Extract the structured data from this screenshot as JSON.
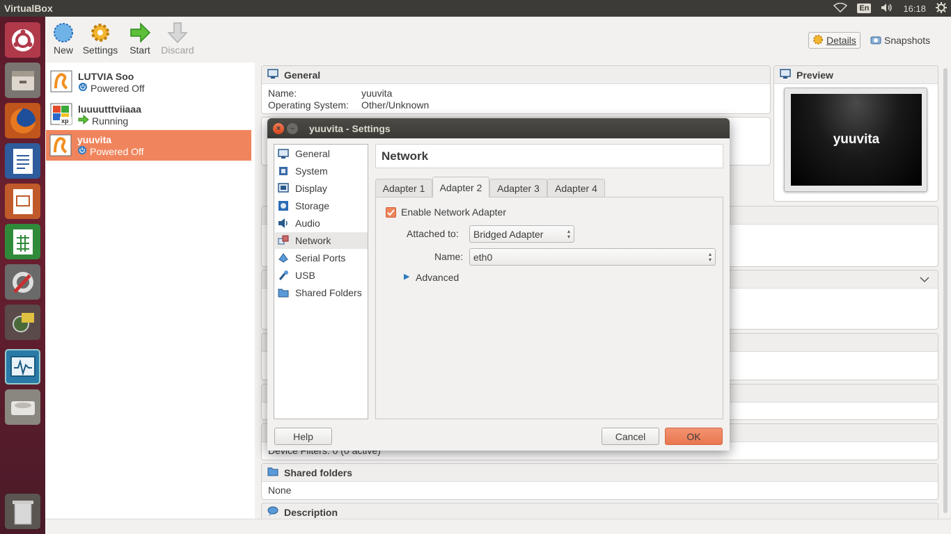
{
  "topbar": {
    "app_title": "VirtualBox",
    "keyboard": "En",
    "time": "16:18"
  },
  "toolbar": {
    "new_label": "New",
    "settings_label": "Settings",
    "start_label": "Start",
    "discard_label": "Discard",
    "details_label": "Details",
    "snapshots_label": "Snapshots"
  },
  "vms": [
    {
      "name": "LUTVIA Soo",
      "state": "Powered Off"
    },
    {
      "name": "luuuutttviiaaa",
      "state": "Running"
    },
    {
      "name": "yuuvita",
      "state": "Powered Off"
    }
  ],
  "details": {
    "general_title": "General",
    "name_key": "Name:",
    "name_val": "yuuvita",
    "os_key": "Operating System:",
    "os_val": "Other/Unknown",
    "preview_title": "Preview",
    "preview_text": "yuuvita",
    "usb_partial": "Device Filters:   0 (0 active)",
    "shared_title": "Shared folders",
    "shared_val": "None",
    "description_title": "Description"
  },
  "dialog": {
    "title": "yuuvita - Settings",
    "categories": [
      "General",
      "System",
      "Display",
      "Storage",
      "Audio",
      "Network",
      "Serial Ports",
      "USB",
      "Shared Folders"
    ],
    "page_title": "Network",
    "tabs": [
      "Adapter 1",
      "Adapter 2",
      "Adapter 3",
      "Adapter 4"
    ],
    "enable_label": "Enable Network Adapter",
    "attached_label": "Attached to:",
    "attached_value": "Bridged Adapter",
    "name_label": "Name:",
    "name_value": "eth0",
    "advanced_label": "Advanced",
    "help_label": "Help",
    "cancel_label": "Cancel",
    "ok_label": "OK"
  }
}
